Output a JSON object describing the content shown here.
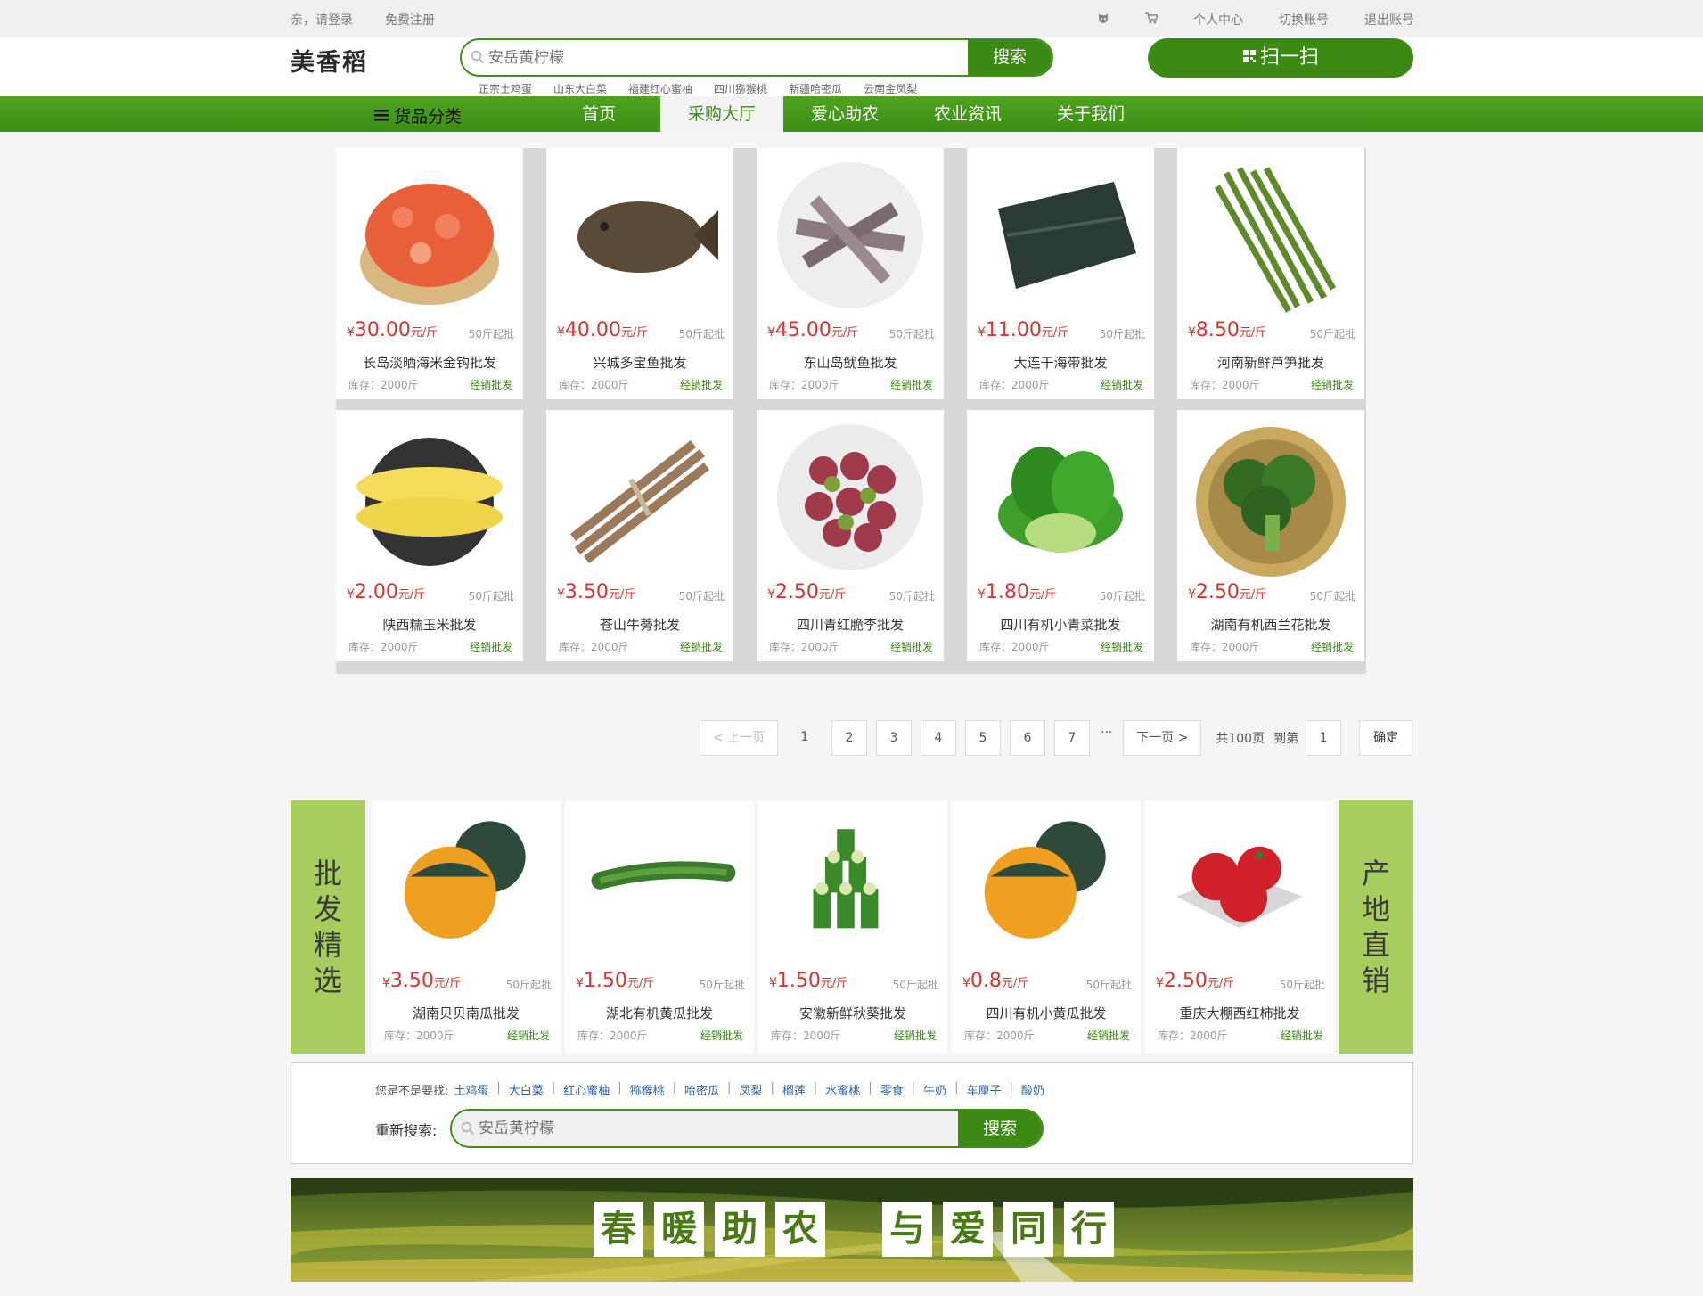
{
  "topbar": {
    "greeting": "亲，请登录",
    "register": "免费注册",
    "personal": "个人中心",
    "switch": "切换账号",
    "logout": "退出账号"
  },
  "header": {
    "logo": "美香稻",
    "search_placeholder": "安岳黄柠檬",
    "search_button": "搜索",
    "scan_button": "扫一扫",
    "hotwords": [
      "正宗土鸡蛋",
      "山东大白菜",
      "福建红心蜜柚",
      "四川猕猴桃",
      "新疆哈密瓜",
      "云南金凤梨"
    ]
  },
  "nav": {
    "category": "货品分类",
    "items": [
      {
        "label": "首页",
        "active": false
      },
      {
        "label": "采购大厅",
        "active": true
      },
      {
        "label": "爱心助农",
        "active": false
      },
      {
        "label": "农业资讯",
        "active": false
      },
      {
        "label": "关于我们",
        "active": false
      }
    ]
  },
  "products": [
    {
      "price": "30.00",
      "unit": "元/斤",
      "min": "50斤起批",
      "name": "长岛淡晒海米金钩批发",
      "stock": "库存：2000斤",
      "tag": "经销批发",
      "icon": "dried-shrimp"
    },
    {
      "price": "40.00",
      "unit": "元/斤",
      "min": "50斤起批",
      "name": "兴城多宝鱼批发",
      "stock": "库存：2000斤",
      "tag": "经销批发",
      "icon": "turbot-fish"
    },
    {
      "price": "45.00",
      "unit": "元/斤",
      "min": "50斤起批",
      "name": "东山岛鱿鱼批发",
      "stock": "库存：2000斤",
      "tag": "经销批发",
      "icon": "squid"
    },
    {
      "price": "11.00",
      "unit": "元/斤",
      "min": "50斤起批",
      "name": "大连干海带批发",
      "stock": "库存：2000斤",
      "tag": "经销批发",
      "icon": "dried-kelp"
    },
    {
      "price": "8.50",
      "unit": "元/斤",
      "min": "50斤起批",
      "name": "河南新鲜芦笋批发",
      "stock": "库存：2000斤",
      "tag": "经销批发",
      "icon": "asparagus"
    },
    {
      "price": "2.00",
      "unit": "元/斤",
      "min": "50斤起批",
      "name": "陕西糯玉米批发",
      "stock": "库存：2000斤",
      "tag": "经销批发",
      "icon": "corn"
    },
    {
      "price": "3.50",
      "unit": "元/斤",
      "min": "50斤起批",
      "name": "苍山牛蒡批发",
      "stock": "库存：2000斤",
      "tag": "经销批发",
      "icon": "burdock"
    },
    {
      "price": "2.50",
      "unit": "元/斤",
      "min": "50斤起批",
      "name": "四川青红脆李批发",
      "stock": "库存：2000斤",
      "tag": "经销批发",
      "icon": "plums"
    },
    {
      "price": "1.80",
      "unit": "元/斤",
      "min": "50斤起批",
      "name": "四川有机小青菜批发",
      "stock": "库存：2000斤",
      "tag": "经销批发",
      "icon": "bok-choy"
    },
    {
      "price": "2.50",
      "unit": "元/斤",
      "min": "50斤起批",
      "name": "湖南有机西兰花批发",
      "stock": "库存：2000斤",
      "tag": "经销批发",
      "icon": "broccoli"
    }
  ],
  "pager": {
    "prev": "< 上一页",
    "pages": [
      "1",
      "2",
      "3",
      "4",
      "5",
      "6",
      "7"
    ],
    "ellipsis": "···",
    "next": "下一页 >",
    "total": "共100页",
    "goto": "到第",
    "goto_value": "1",
    "confirm": "确定"
  },
  "featured": {
    "left_title": "批发精选",
    "right_title": "产地直销",
    "items": [
      {
        "price": "3.50",
        "unit": "元/斤",
        "min": "50斤起批",
        "name": "湖南贝贝南瓜批发",
        "stock": "库存：2000斤",
        "tag": "经销批发",
        "icon": "pumpkin"
      },
      {
        "price": "1.50",
        "unit": "元/斤",
        "min": "50斤起批",
        "name": "湖北有机黄瓜批发",
        "stock": "库存：2000斤",
        "tag": "经销批发",
        "icon": "cucumber"
      },
      {
        "price": "1.50",
        "unit": "元/斤",
        "min": "50斤起批",
        "name": "安徽新鲜秋葵批发",
        "stock": "库存：2000斤",
        "tag": "经销批发",
        "icon": "okra"
      },
      {
        "price": "0.8",
        "unit": "元/斤",
        "min": "50斤起批",
        "name": "四川有机小黄瓜批发",
        "stock": "库存：2000斤",
        "tag": "经销批发",
        "icon": "pumpkin"
      },
      {
        "price": "2.50",
        "unit": "元/斤",
        "min": "50斤起批",
        "name": "重庆大棚西红柿批发",
        "stock": "库存：2000斤",
        "tag": "经销批发",
        "icon": "tomato"
      }
    ]
  },
  "research": {
    "suggest_label": "您是不是要找:",
    "suggestions": [
      "土鸡蛋",
      "大白菜",
      "红心蜜柚",
      "猕猴桃",
      "哈密瓜",
      "凤梨",
      "榴莲",
      "水蜜桃",
      "零食",
      "牛奶",
      "车厘子",
      "酸奶"
    ],
    "label": "重新搜索:",
    "placeholder": "安岳黄柠檬",
    "button": "搜索"
  },
  "banner": {
    "left": [
      "春",
      "暖",
      "助",
      "农"
    ],
    "right": [
      "与",
      "爱",
      "同",
      "行"
    ]
  },
  "colors": {
    "brand": "#3a8a14",
    "price": "#e03030",
    "side": "#a8cd5f"
  }
}
